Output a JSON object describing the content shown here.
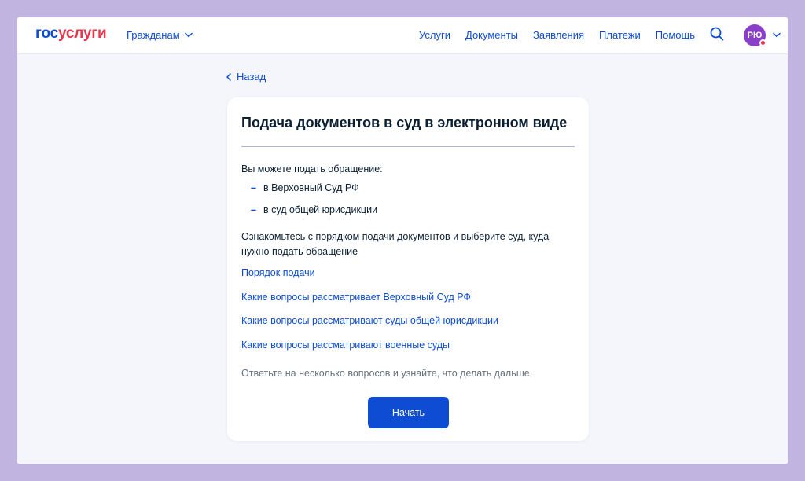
{
  "header": {
    "logo_part1": "гос",
    "logo_part2": "услуги",
    "audience_menu": "Гражданам",
    "nav": [
      "Услуги",
      "Документы",
      "Заявления",
      "Платежи",
      "Помощь"
    ],
    "avatar_initials": "РЮ"
  },
  "back_label": "Назад",
  "card": {
    "title": "Подача документов в суд в электронном виде",
    "intro": "Вы можете подать обращение:",
    "bullets": [
      "в Верховный Суд РФ",
      "в суд общей юрисдикции"
    ],
    "paragraph": "Ознакомьтесь с порядком подачи документов и выберите суд, куда нужно подать обращение",
    "links": [
      "Порядок подачи",
      "Какие вопросы рассматривает Верховный Суд РФ",
      "Какие вопросы рассматривают суды общей юрисдикции",
      "Какие вопросы рассматривают военные суды"
    ],
    "hint": "Ответьте на несколько вопросов и узнайте, что делать дальше",
    "start_button": "Начать"
  },
  "colors": {
    "brand_blue": "#0d4cd3",
    "brand_red": "#e8364f",
    "avatar": "#8a3fc9",
    "text": "#0b1f33",
    "muted": "#66727f"
  },
  "icons": [
    "chevron-down-icon",
    "search-icon",
    "chevron-left-icon"
  ]
}
